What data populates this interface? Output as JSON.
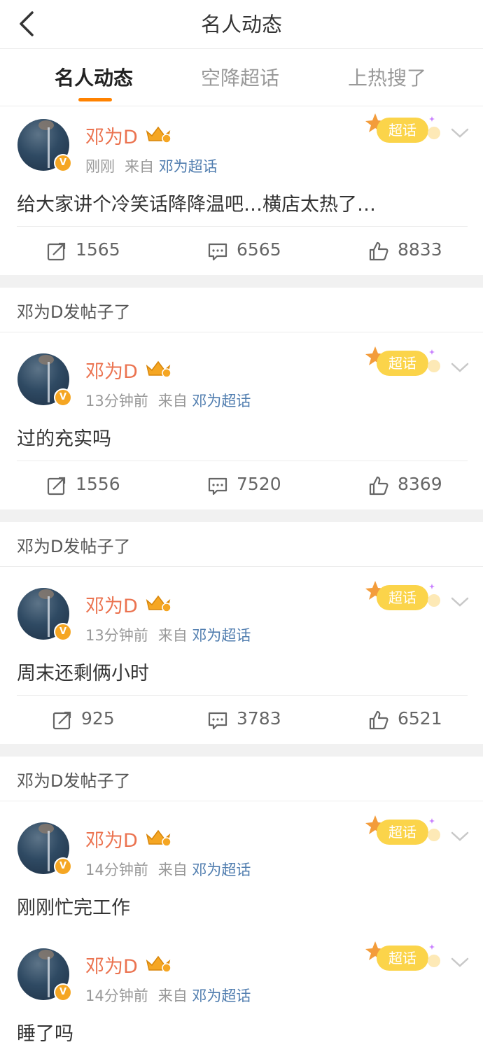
{
  "header": {
    "title": "名人动态",
    "back_icon": "chevron-left-icon"
  },
  "tabs": [
    {
      "label": "名人动态",
      "active": true
    },
    {
      "label": "空降超话",
      "active": false
    },
    {
      "label": "上热搜了",
      "active": false
    }
  ],
  "section_title": "邓为D发帖子了",
  "colors": {
    "accent": "#ff8200",
    "username": "#eb7350",
    "link": "#507daf",
    "badge": "#fbd44a"
  },
  "posts": [
    {
      "username": "邓为D",
      "time": "刚刚",
      "from_label": "来自",
      "source": "邓为超话",
      "badge": "超话",
      "content": "给大家讲个冷笑话降降温吧…横店太热了…",
      "reposts": "1565",
      "comments": "6565",
      "likes": "8833"
    },
    {
      "username": "邓为D",
      "time": "13分钟前",
      "from_label": "来自",
      "source": "邓为超话",
      "badge": "超话",
      "content": "过的充实吗",
      "reposts": "1556",
      "comments": "7520",
      "likes": "8369"
    },
    {
      "username": "邓为D",
      "time": "13分钟前",
      "from_label": "来自",
      "source": "邓为超话",
      "badge": "超话",
      "content": "周末还剩俩小时",
      "reposts": "925",
      "comments": "3783",
      "likes": "6521"
    },
    {
      "username": "邓为D",
      "time": "14分钟前",
      "from_label": "来自",
      "source": "邓为超话",
      "badge": "超话",
      "content": "刚刚忙完工作"
    },
    {
      "username": "邓为D",
      "time": "14分钟前",
      "from_label": "来自",
      "source": "邓为超话",
      "badge": "超话",
      "content": "睡了吗"
    }
  ]
}
